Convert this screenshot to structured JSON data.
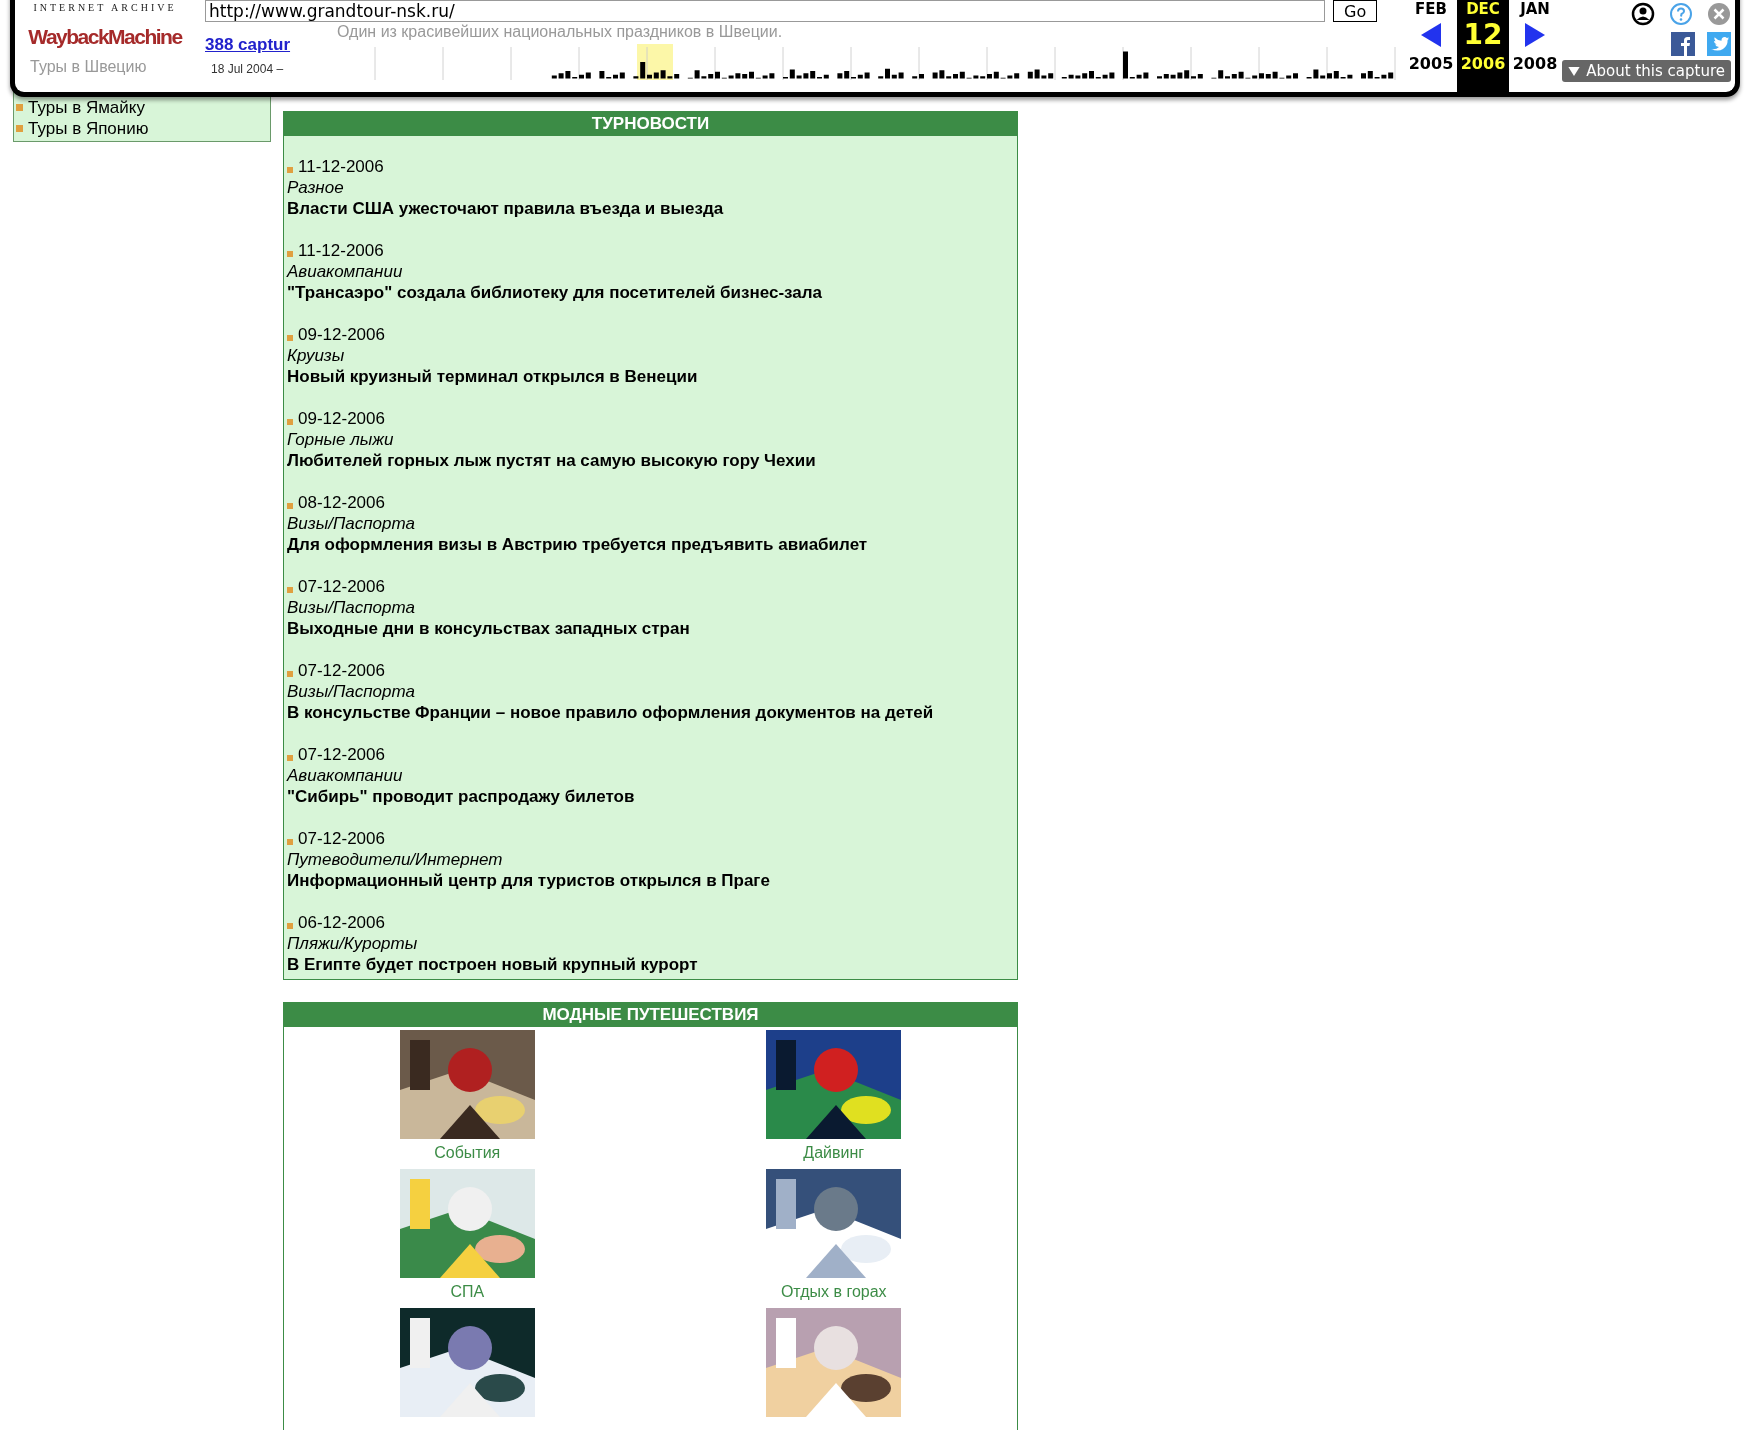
{
  "toolbar": {
    "logo_caption": "INTERNET ARCHIVE",
    "logo": "WaybackMachine",
    "url": "http://www.grandtour-nsk.ru/",
    "go": "Go",
    "captures_link": "388 captur",
    "date_range": "18 Jul 2004 –",
    "ghost_texts": [
      "Один из красивейших национальных праздников в Швеции.",
      "Туры в Швецию"
    ],
    "months": [
      {
        "month": "FEB",
        "year": "2005",
        "selected": false
      },
      {
        "month": "DEC",
        "day": "12",
        "year": "2006",
        "selected": true
      },
      {
        "month": "JAN",
        "year": "2008",
        "selected": false
      }
    ],
    "about": "About this capture"
  },
  "sidebar": {
    "items": [
      "Туры в Ямайку",
      "Туры в Японию"
    ]
  },
  "news": {
    "title": "ТУРНОВОСТИ",
    "items": [
      {
        "date": "11-12-2006",
        "category": "Разное",
        "headline": "Власти США ужесточают правила въезда и выезда"
      },
      {
        "date": "11-12-2006",
        "category": "Авиакомпании",
        "headline": "\"Трансаэро\" создала библиотеку для посетителей бизнес-зала"
      },
      {
        "date": "09-12-2006",
        "category": "Круизы",
        "headline": "Новый круизный терминал открылся в Венеции"
      },
      {
        "date": "09-12-2006",
        "category": "Горные лыжи",
        "headline": "Любителей горных лыж пустят на самую высокую гору Чехии"
      },
      {
        "date": "08-12-2006",
        "category": "Визы/Паспорта",
        "headline": "Для оформления визы в Австрию требуется предъявить авиабилет"
      },
      {
        "date": "07-12-2006",
        "category": "Визы/Паспорта",
        "headline": "Выходные дни в консульствах западных стран"
      },
      {
        "date": "07-12-2006",
        "category": "Визы/Паспорта",
        "headline": "В консульстве Франции – новое правило оформления документов на детей"
      },
      {
        "date": "07-12-2006",
        "category": "Авиакомпании",
        "headline": "\"Сибирь\" проводит распродажу билетов"
      },
      {
        "date": "07-12-2006",
        "category": "Путеводители/Интернет",
        "headline": "Информационный центр для туристов открылся в Праге"
      },
      {
        "date": "06-12-2006",
        "category": "Пляжи/Курорты",
        "headline": "В Египте будет построен новый крупный курорт"
      }
    ]
  },
  "trips": {
    "title": "МОДНЫЕ ПУТЕШЕСТВИЯ",
    "items": [
      {
        "kind": "picture",
        "caption": "События"
      },
      {
        "kind": "picture",
        "caption": "Дайвинг"
      },
      {
        "kind": "picture",
        "caption": "СПА"
      },
      {
        "kind": "picture",
        "caption": "Отдых в горах"
      },
      {
        "kind": "picture"
      },
      {
        "kind": "picture"
      }
    ]
  }
}
